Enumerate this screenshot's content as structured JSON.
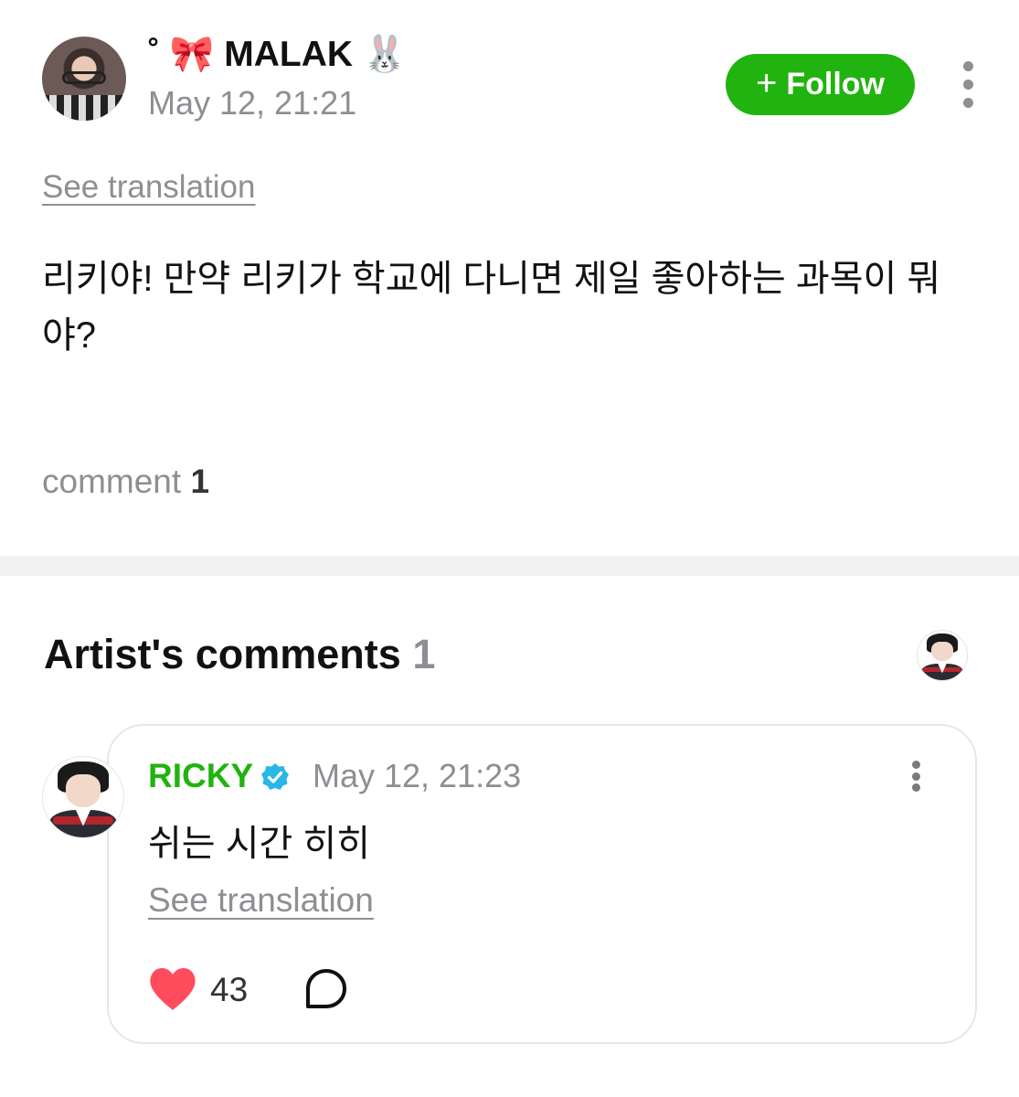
{
  "post": {
    "author": "˚ 🎀 MALAK 🐰",
    "timestamp": "May 12, 21:21",
    "follow_label": "Follow",
    "see_translation": "See translation",
    "body": "리키야! 만약 리키가 학교에 다니면 제일 좋아하는 과목이 뭐야?",
    "comment_label": "comment",
    "comment_count": "1"
  },
  "artist_comments": {
    "title": "Artist's comments",
    "count": "1",
    "items": [
      {
        "name": "RICKY",
        "timestamp": "May 12, 21:23",
        "text": "쉬는 시간 히히",
        "see_translation": "See translation",
        "likes": "43"
      }
    ]
  },
  "colors": {
    "accent_green": "#21b30f",
    "verified_blue": "#29b6e8",
    "heart_red": "#ff4d5e",
    "muted_gray": "#8e8e93"
  },
  "icons": [
    "plus-icon",
    "more-vertical-icon",
    "verified-badge-icon",
    "heart-icon",
    "reply-bubble-icon"
  ]
}
